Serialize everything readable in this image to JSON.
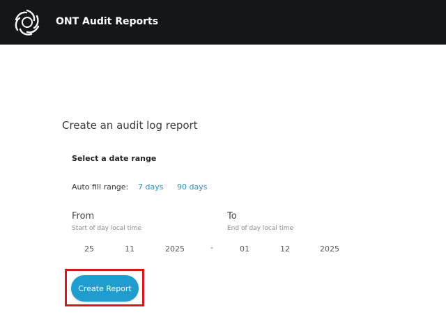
{
  "header": {
    "app_title": "ONT Audit Reports",
    "logo_icon": "swirl-logo-icon"
  },
  "page": {
    "title": "Create an audit log report"
  },
  "range": {
    "section_title": "Select a date range",
    "autofill_label": "Auto fill range:",
    "links": [
      "7 days",
      "90 days"
    ]
  },
  "from": {
    "label": "From",
    "hint": "Start of day local time",
    "day": "25",
    "month": "11",
    "year": "2025"
  },
  "separator": "-",
  "to": {
    "label": "To",
    "hint": "End of day local time",
    "day": "01",
    "month": "12",
    "year": "2025"
  },
  "actions": {
    "create_label": "Create Report"
  },
  "colors": {
    "header_bg": "#151618",
    "accent": "#1f9dcf",
    "link": "#2f8fb5",
    "highlight": "#d9171c"
  }
}
